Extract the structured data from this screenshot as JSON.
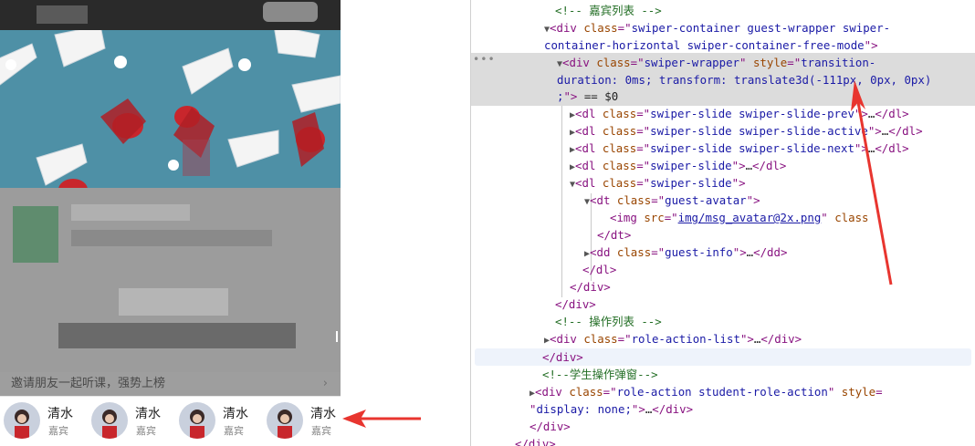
{
  "phone": {
    "invite_text": "邀请朋友一起听课，强势上榜",
    "invite_chevron": "›",
    "guests": [
      {
        "name": "清水",
        "role": "嘉宾"
      },
      {
        "name": "清水",
        "role": "嘉宾"
      },
      {
        "name": "清水",
        "role": "嘉宾"
      },
      {
        "name": "清水",
        "role": "嘉宾"
      }
    ],
    "colors": {
      "banner": "#4e90a6",
      "shuttle_red": "#c8262c",
      "arrow": "#e8352f"
    }
  },
  "devtools": {
    "dots": "•••",
    "l1": {
      "comment": "<!-- 嘉宾列表 -->"
    },
    "l2": {
      "open": "<div",
      "attr": "class",
      "eq": "=\"",
      "val": "swiper-container guest-wrapper swiper-",
      "close": ""
    },
    "l3": {
      "val": "container-horizontal swiper-container-free-mode",
      "end": "\">"
    },
    "l4": {
      "open": "<div",
      "attr": "class",
      "val": "swiper-wrapper",
      "attr2": "style",
      "val2": "transition-"
    },
    "l5": {
      "val": "duration: 0ms; transform: translate3d(-111px, 0px, 0px)"
    },
    "l6": {
      "val": ";",
      "end": "\">",
      "eq": " == $0"
    },
    "slides": [
      {
        "cls": "swiper-slide swiper-slide-prev",
        "tail": "…</dl>"
      },
      {
        "cls": "swiper-slide swiper-slide-active",
        "tail": "…</dl>"
      },
      {
        "cls": "swiper-slide swiper-slide-next",
        "tail": "…</dl>"
      },
      {
        "cls": "swiper-slide",
        "tail": "…</dl>"
      }
    ],
    "open_slide": {
      "cls": "swiper-slide"
    },
    "dt": {
      "cls": "guest-avatar"
    },
    "img": {
      "src": "img/msg_avatar@2x.png",
      "attr": "class"
    },
    "dt_close": "</dt>",
    "dd": {
      "cls": "guest-info",
      "tail": "…</dd>"
    },
    "dl_close": "</dl>",
    "div_close_a": "</div>",
    "div_close_b": "</div>",
    "c2": "<!-- 操作列表 -->",
    "action_list": {
      "cls": "role-action-list",
      "tail": "…</div>"
    },
    "div_close_c": "</div>",
    "c3": "<!--学生操作弹窗-->",
    "student": {
      "cls": "role-action student-role-action",
      "attr": "style",
      "val": "display: none;",
      "tail": "…</div>"
    },
    "div_close_d": "</div>",
    "div_close_e": "</div>"
  }
}
